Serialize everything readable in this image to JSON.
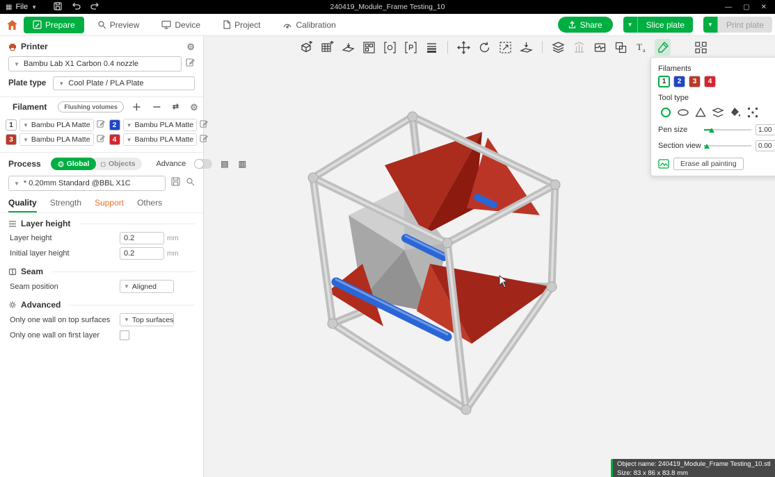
{
  "titlebar": {
    "menu": "File",
    "title": "240419_Module_Frame Testing_10"
  },
  "nav": {
    "tabs": [
      {
        "label": "Prepare",
        "active": true
      },
      {
        "label": "Preview",
        "active": false
      },
      {
        "label": "Device",
        "active": false
      },
      {
        "label": "Project",
        "active": false
      },
      {
        "label": "Calibration",
        "active": false
      }
    ],
    "share_label": "Share",
    "slice_label": "Slice plate",
    "print_label": "Print plate"
  },
  "sidebar": {
    "printer": {
      "title": "Printer",
      "preset": "Bambu Lab X1 Carbon 0.4 nozzle",
      "plate_type_label": "Plate type",
      "plate_type_value": "Cool Plate / PLA Plate"
    },
    "filament": {
      "title": "Filament",
      "flushing_label": "Flushing volumes",
      "items": [
        {
          "id": "1",
          "name": "Bambu PLA Matte",
          "color": "#ffffff",
          "text_color": "#333333"
        },
        {
          "id": "2",
          "name": "Bambu PLA Matte",
          "color": "#1f46c8",
          "text_color": "#ffffff"
        },
        {
          "id": "3",
          "name": "Bambu PLA Matte",
          "color": "#bb3a27",
          "text_color": "#ffffff"
        },
        {
          "id": "4",
          "name": "Bambu PLA Matte",
          "color": "#d8242f",
          "text_color": "#ffffff"
        }
      ]
    },
    "process": {
      "title": "Process",
      "global_label": "Global",
      "objects_label": "Objects",
      "advance_label": "Advance",
      "preset": "* 0.20mm Standard @BBL X1C",
      "tabs": [
        {
          "label": "Quality"
        },
        {
          "label": "Strength"
        },
        {
          "label": "Support"
        },
        {
          "label": "Others"
        }
      ]
    },
    "groups": [
      {
        "title": "Layer height",
        "rows": [
          {
            "label": "Layer height",
            "value": "0.2",
            "unit": "mm"
          },
          {
            "label": "Initial layer height",
            "value": "0.2",
            "unit": "mm"
          }
        ]
      },
      {
        "title": "Seam",
        "rows": [
          {
            "label": "Seam position",
            "value": "Aligned"
          }
        ]
      },
      {
        "title": "Advanced",
        "rows": [
          {
            "label": "Only one wall on top surfaces",
            "value": "Top surfaces"
          },
          {
            "label": "Only one wall on first layer",
            "checked": false
          }
        ]
      }
    ]
  },
  "paint": {
    "filaments_label": "Filaments",
    "filaments": [
      {
        "id": "1",
        "color": "#ffffff",
        "text_color": "#333333",
        "selected": true
      },
      {
        "id": "2",
        "color": "#1f46c8",
        "text_color": "#ffffff",
        "selected": false
      },
      {
        "id": "3",
        "color": "#bb3a27",
        "text_color": "#ffffff",
        "selected": false
      },
      {
        "id": "4",
        "color": "#d8242f",
        "text_color": "#ffffff",
        "selected": false
      }
    ],
    "tool_type_label": "Tool type",
    "pen_size_label": "Pen size",
    "pen_size_value": "1.00",
    "section_view_label": "Section view",
    "section_view_value": "0.00",
    "erase_label": "Erase all painting"
  },
  "info_box": {
    "line1": "Object name: 240419_Module_Frame Testing_10.stl",
    "line2": "Size: 83 x 86 x 83.8 mm"
  },
  "colors": {
    "accent_green": "#00ae42",
    "support_tab_orange": "#f0722c",
    "titlebar": "#000000",
    "viewport_bg": "#f2f2f2"
  }
}
